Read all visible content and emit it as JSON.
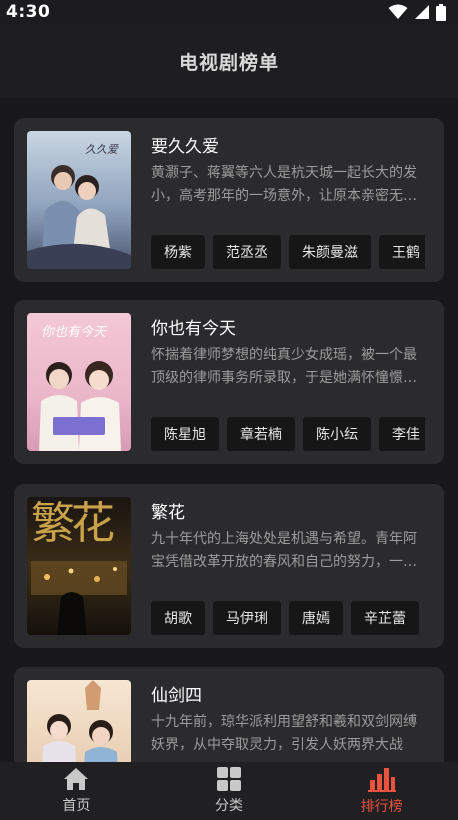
{
  "status": {
    "time": "4:30"
  },
  "header": {
    "title": "电视剧榜单"
  },
  "dramas": [
    {
      "title": "要久久爱",
      "poster_caption": "久久爱",
      "description": "黄灏子、蒋翼等六人是杭天城一起长大的发小，高考那年的一场意外，让原本亲密无间的他们",
      "cast": [
        "杨紫",
        "范丞丞",
        "朱颜曼滋",
        "王鹤"
      ]
    },
    {
      "title": "你也有今天",
      "poster_caption": "你也有今天",
      "description": "怀揣着律师梦想的纯真少女成瑶，被一个最顶级的律师事务所录取，于是她满怀憧憬地入职了",
      "cast": [
        "陈星旭",
        "章若楠",
        "陈小纭",
        "李佳"
      ]
    },
    {
      "title": "繁花",
      "poster_caption": "繁花",
      "description": "九十年代的上海处处是机遇与希望。青年阿宝凭借改革开放的春风和自己的努力，一跃成为商界",
      "cast": [
        "胡歌",
        "马伊琍",
        "唐嫣",
        "辛芷蕾"
      ]
    },
    {
      "title": "仙剑四",
      "poster_caption": "",
      "description": "十九年前，琼华派利用望舒和羲和双剑网缚妖界，从中夺取灵力，引发人妖两界大战",
      "cast": []
    }
  ],
  "tabbar": {
    "items": [
      {
        "label": "首页",
        "icon": "home-icon"
      },
      {
        "label": "分类",
        "icon": "grid-icon"
      },
      {
        "label": "排行榜",
        "icon": "ranking-icon"
      }
    ],
    "active_index": 2
  },
  "colors": {
    "accent": "#e8523f",
    "background": "#1c1c1e",
    "card": "#2b2b2d",
    "chip": "#161617"
  }
}
